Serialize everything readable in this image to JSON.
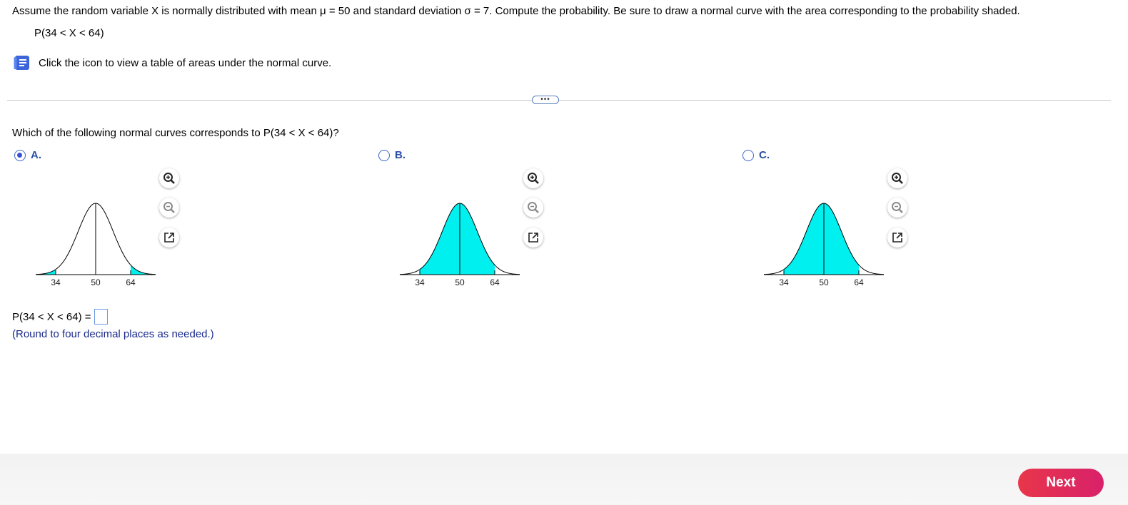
{
  "problem": {
    "statement": "Assume the random variable X is normally distributed with mean μ = 50 and standard deviation σ = 7. Compute the probability. Be sure to draw a normal curve with the area corresponding to the probability shaded.",
    "expression": "P(34 < X < 64)"
  },
  "table_link": {
    "text": "Click the icon to view a table of areas under the normal curve.",
    "icon": "book-icon"
  },
  "more_button": {
    "label": "•••"
  },
  "question": {
    "text": "Which of the following normal curves corresponds to P(34 < X < 64)?",
    "options": [
      {
        "letter": "A.",
        "selected": true,
        "shading": "tails",
        "ticks": [
          "34",
          "50",
          "64"
        ]
      },
      {
        "letter": "B.",
        "selected": false,
        "shading": "between",
        "ticks": [
          "34",
          "50",
          "64"
        ]
      },
      {
        "letter": "C.",
        "selected": false,
        "shading": "between",
        "ticks": [
          "34",
          "50",
          "64"
        ]
      }
    ]
  },
  "zoom_tools": {
    "icons": [
      "zoom-in-icon",
      "zoom-out-icon",
      "expand-icon"
    ]
  },
  "answer": {
    "label": "P(34 < X < 64) =",
    "value": "",
    "note": "(Round to four decimal places as needed.)"
  },
  "footer": {
    "next_label": "Next"
  },
  "colors": {
    "shade": "#00f0f0",
    "accent": "#2b4fa8",
    "next_gradient_start": "#e8364a",
    "next_gradient_end": "#d8216a"
  }
}
